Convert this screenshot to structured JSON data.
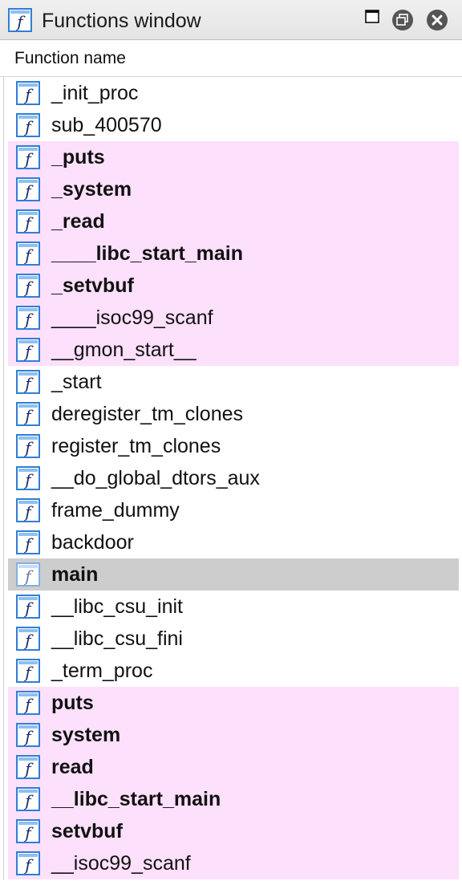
{
  "window": {
    "title": "Functions window",
    "title_icon": "function-icon",
    "controls": [
      "maximize-icon",
      "restore-icon",
      "close-icon"
    ]
  },
  "header": {
    "column": "Function name"
  },
  "colors": {
    "import_row": "#fde0fb",
    "selected_row": "#cdcdcd",
    "icon_blue": "#2f7ed8"
  },
  "functions": [
    {
      "name": "_init_proc",
      "style": "plain",
      "bold": false
    },
    {
      "name": "sub_400570",
      "style": "plain",
      "bold": false
    },
    {
      "name": "_puts",
      "style": "import",
      "bold": true
    },
    {
      "name": "_system",
      "style": "import",
      "bold": true
    },
    {
      "name": "_read",
      "style": "import",
      "bold": true
    },
    {
      "name": "____libc_start_main",
      "style": "import",
      "bold": true
    },
    {
      "name": "_setvbuf",
      "style": "import",
      "bold": true
    },
    {
      "name": "____isoc99_scanf",
      "style": "import",
      "bold": false
    },
    {
      "name": "__gmon_start__",
      "style": "import",
      "bold": false
    },
    {
      "name": "_start",
      "style": "plain",
      "bold": false
    },
    {
      "name": "deregister_tm_clones",
      "style": "plain",
      "bold": false
    },
    {
      "name": "register_tm_clones",
      "style": "plain",
      "bold": false
    },
    {
      "name": "__do_global_dtors_aux",
      "style": "plain",
      "bold": false
    },
    {
      "name": "frame_dummy",
      "style": "plain",
      "bold": false
    },
    {
      "name": "backdoor",
      "style": "plain",
      "bold": false
    },
    {
      "name": "main",
      "style": "selected",
      "bold": true
    },
    {
      "name": "__libc_csu_init",
      "style": "plain",
      "bold": false
    },
    {
      "name": "__libc_csu_fini",
      "style": "plain",
      "bold": false
    },
    {
      "name": "_term_proc",
      "style": "plain",
      "bold": false
    },
    {
      "name": "puts",
      "style": "import",
      "bold": true
    },
    {
      "name": "system",
      "style": "import",
      "bold": true
    },
    {
      "name": "read",
      "style": "import",
      "bold": true
    },
    {
      "name": "__libc_start_main",
      "style": "import",
      "bold": true
    },
    {
      "name": "setvbuf",
      "style": "import",
      "bold": true
    },
    {
      "name": "__isoc99_scanf",
      "style": "import",
      "bold": false
    }
  ]
}
